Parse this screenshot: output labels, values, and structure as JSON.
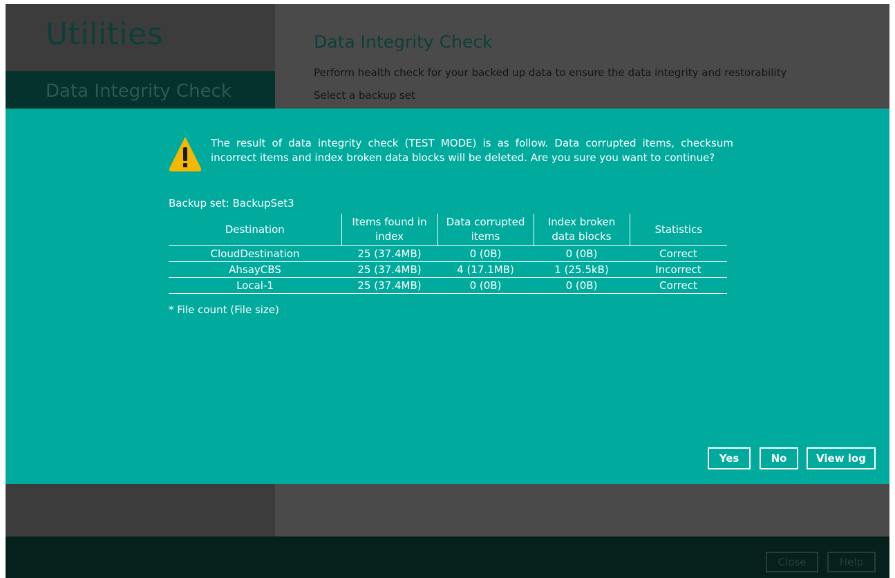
{
  "sidebar": {
    "title": "Utilities",
    "selected_item": "Data Integrity Check"
  },
  "main": {
    "title": "Data Integrity Check",
    "description": "Perform health check for your backed up data to ensure the data integrity and restorability",
    "select_label": "Select a backup set"
  },
  "dialog": {
    "icon": "warning-icon",
    "message": "The result of data integrity check (TEST MODE) is as follow. Data corrupted items, checksum incorrect items and index broken data blocks will be deleted. Are you sure you want to continue?",
    "backup_set_label": "Backup set: BackupSet3",
    "columns": [
      "Destination",
      "Items found in index",
      "Data corrupted items",
      "Index broken data blocks",
      "Statistics"
    ],
    "rows": [
      [
        "CloudDestination",
        "25 (37.4MB)",
        "0 (0B)",
        "0 (0B)",
        "Correct"
      ],
      [
        "AhsayCBS",
        "25 (37.4MB)",
        "4 (17.1MB)",
        "1 (25.5kB)",
        "Incorrect"
      ],
      [
        "Local-1",
        "25 (37.4MB)",
        "0 (0B)",
        "0 (0B)",
        "Correct"
      ]
    ],
    "footnote": "* File count (File size)",
    "buttons": {
      "yes": "Yes",
      "no": "No",
      "view_log": "View log"
    }
  },
  "footer": {
    "close_label": "Close",
    "help_label": "Help"
  },
  "colors": {
    "modal_bg": "#00aa9d",
    "warning_fill": "#f5b800",
    "sidebar_selected": "#04332d"
  }
}
